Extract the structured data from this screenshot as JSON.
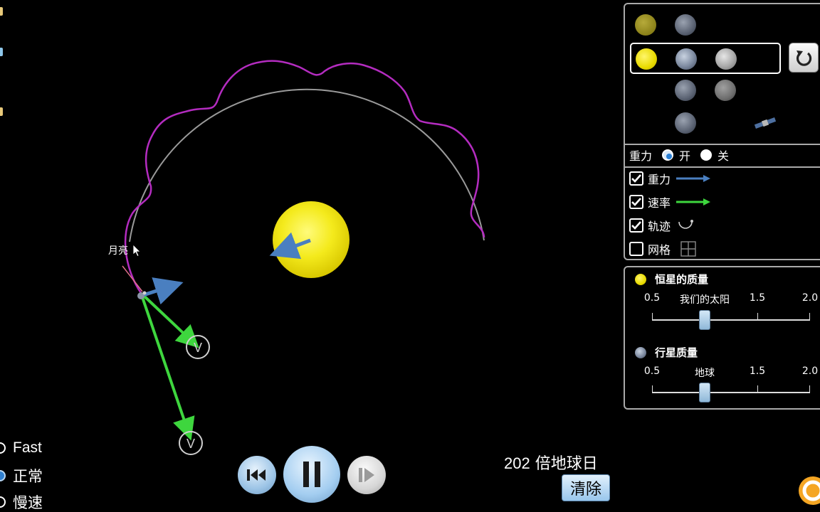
{
  "sim": {
    "moon_label": "月亮",
    "colors": {
      "orbit_path": "#b42cc0",
      "reference_circle": "#9a9a9a",
      "gravity_arrow": "#4a7fc0",
      "velocity_arrow": "#3ed63e",
      "star": "#f4ea1c"
    },
    "velocity_handle_glyph": "V"
  },
  "body_panel": {
    "presets": [
      {
        "bodies": [
          "sun-icon",
          "planet-icon"
        ]
      },
      {
        "bodies": [
          "sun-icon",
          "planet-icon",
          "moon-icon"
        ],
        "selected": true
      },
      {
        "bodies": [
          "planet-icon",
          "moon-icon"
        ]
      },
      {
        "bodies": [
          "planet-icon",
          "satellite-icon"
        ]
      }
    ],
    "reset_icon": "reset-icon",
    "gravity_toggle": {
      "label": "重力",
      "on_label": "开",
      "off_label": "关",
      "value": "开"
    },
    "options": [
      {
        "label": "重力",
        "checked": true,
        "icon": "gravity-arrow-icon"
      },
      {
        "label": "速率",
        "checked": true,
        "icon": "velocity-arrow-icon"
      },
      {
        "label": "轨迹",
        "checked": true,
        "icon": "path-icon"
      },
      {
        "label": "网格",
        "checked": false,
        "icon": "grid-icon"
      }
    ]
  },
  "slider_panel": {
    "star_mass": {
      "title": "恒星的质量",
      "ticks": [
        "0.5",
        "我们的太阳",
        "1.5",
        "2.0"
      ],
      "value": 1.0,
      "range": [
        0.5,
        2.0
      ]
    },
    "planet_mass": {
      "title": "行星质量",
      "ticks": [
        "0.5",
        "地球",
        "1.5",
        "2.0"
      ],
      "value": 1.0,
      "range": [
        0.5,
        2.0
      ]
    }
  },
  "speed": {
    "options": [
      "Fast",
      "正常",
      "慢速"
    ],
    "selected": "正常"
  },
  "controls": {
    "time_value": "202",
    "time_unit": "倍地球日",
    "clear_label": "清除"
  },
  "edge_tab_colors": [
    "#e8c97a",
    "#8ec7ea",
    "#e8c97a"
  ]
}
